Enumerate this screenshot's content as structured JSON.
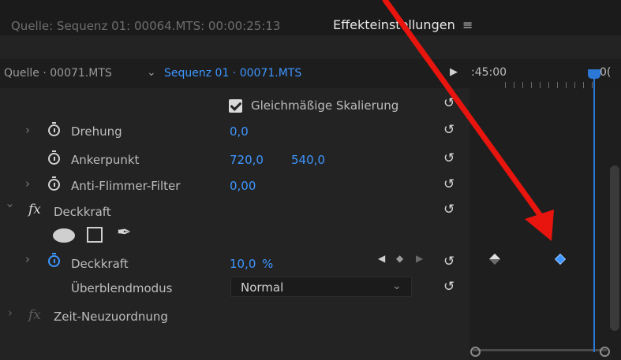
{
  "window": {
    "source_tab": "Quelle: Sequenz 01: 00064.MTS: 00:00:25:13",
    "effects_tab": "Effekteinstellungen",
    "menu_icon": "hamburger-icon"
  },
  "header": {
    "source_clip": "Quelle · 00071.MTS",
    "sequence": "Sequenz 01 · 00071.MTS",
    "timecode": ":45:00",
    "playhead_label": "0("
  },
  "properties": {
    "uniform_scale": {
      "label": "Gleichmäßige Skalierung",
      "checked": true
    },
    "rotation": {
      "label": "Drehung",
      "value": "0,0"
    },
    "anchor": {
      "label": "Ankerpunkt",
      "x": "720,0",
      "y": "540,0"
    },
    "flicker": {
      "label": "Anti-Flimmer-Filter",
      "value": "0,00"
    },
    "opacity_group": {
      "label": "Deckkraft"
    },
    "opacity": {
      "label": "Deckkraft",
      "value": "10,0",
      "unit": "%"
    },
    "blend": {
      "label": "Überblendmodus",
      "value": "Normal"
    },
    "time_remap": {
      "label": "Zeit-Neuzuordnung"
    }
  },
  "colors": {
    "accent": "#3d96ff",
    "panel": "#232323",
    "annotation_arrow": "#e8150f"
  },
  "keyframes": [
    {
      "state": "unselected"
    },
    {
      "state": "selected"
    }
  ]
}
